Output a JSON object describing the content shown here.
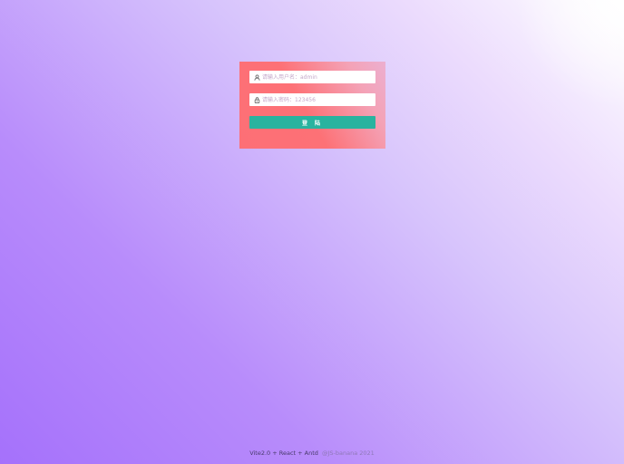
{
  "login": {
    "username_placeholder": "请输入用户名：admin",
    "password_placeholder": "请输入密码：123456",
    "submit_label": "登 陆"
  },
  "footer": {
    "stack": "Vite2.0 + React + Antd",
    "author": "@JS-banana 2021"
  },
  "colors": {
    "background_start": "#a571fb",
    "background_end": "#ffffff",
    "card_start": "#fd6f76",
    "card_end": "#ecafd0",
    "button": "#29b39f"
  },
  "icons": {
    "username": "user-icon",
    "password": "lock-icon"
  }
}
